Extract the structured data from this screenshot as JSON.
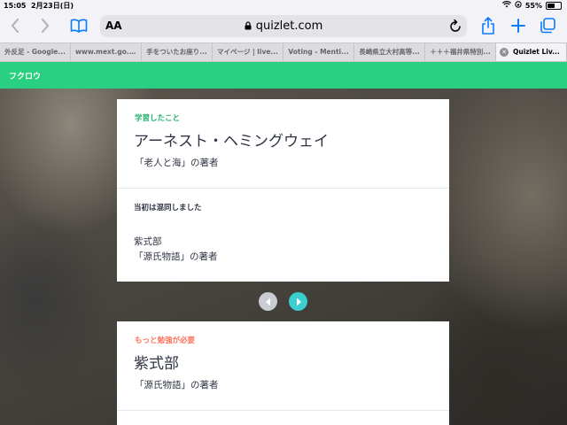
{
  "status": {
    "time": "15:05",
    "date": "2月23日(日)",
    "battery": "55%",
    "battery_level": 0.55
  },
  "browser": {
    "text_size_label": "AA",
    "url": "quizlet.com"
  },
  "tabs": [
    {
      "label": "外反足 - Google..."
    },
    {
      "label": "www.mext.go...."
    },
    {
      "label": "手をついたお座り..."
    },
    {
      "label": "マイページ | live..."
    },
    {
      "label": "Voting - Menti..."
    },
    {
      "label": "長崎県立大村高等..."
    },
    {
      "label": "＋＋＋福井県特別..."
    },
    {
      "label": "Quizlet Liv..."
    }
  ],
  "app": {
    "name": "フクロウ"
  },
  "card1": {
    "status_label": "学習したこと",
    "term": "アーネスト・ヘミングウェイ",
    "definition": "「老人と海」の著者",
    "confused_label": "当初は混同しました",
    "confused_term": "紫式部",
    "confused_definition": "「源氏物語」の著者"
  },
  "card2": {
    "status_label": "もっと勉強が必要",
    "term": "紫式部",
    "definition": "「源氏物語」の著者"
  },
  "colors": {
    "accent_green": "#2ad081",
    "learned_label": "#23b26d",
    "study_label": "#ff725b",
    "next_button": "#3ccfcf"
  }
}
